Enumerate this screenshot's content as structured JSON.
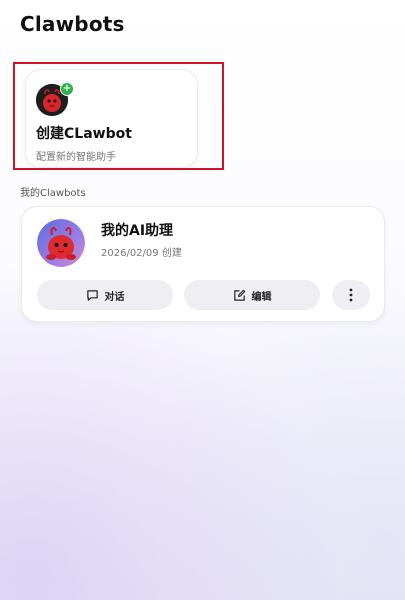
{
  "header": {
    "title": "Clawbots"
  },
  "create_card": {
    "title": "创建CLawbot",
    "subtitle": "配置新的智能助手",
    "badge": "+"
  },
  "section": {
    "label": "我的Clawbots"
  },
  "bots": [
    {
      "name": "我的AI助理",
      "created": "2026/02/09 创建",
      "actions": {
        "chat": "对话",
        "edit": "编辑"
      }
    }
  ],
  "colors": {
    "highlight": "#d3102a",
    "badge": "#2db34a",
    "button_bg": "#efeff3"
  },
  "icons": [
    "plus-icon",
    "chat-bubble-icon",
    "edit-icon",
    "more-vertical-icon"
  ]
}
